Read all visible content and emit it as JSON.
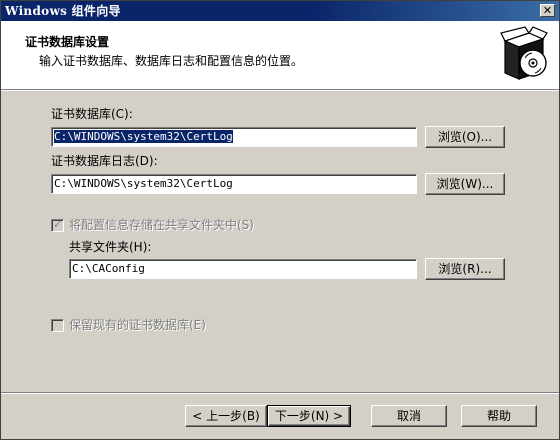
{
  "window": {
    "title": "Windows 组件向导",
    "close_glyph": "✕"
  },
  "header": {
    "title": "证书数据库设置",
    "subtitle": "输入证书数据库、数据库日志和配置信息的位置。",
    "icon": "setup-box-cd-icon"
  },
  "fields": {
    "db_label": "证书数据库(C):",
    "db_value": "C:\\WINDOWS\\system32\\CertLog",
    "db_browse": "浏览(O)...",
    "log_label": "证书数据库日志(D):",
    "log_value": "C:\\WINDOWS\\system32\\CertLog",
    "log_browse": "浏览(W)...",
    "share_check_label": "将配置信息存储在共享文件夹中(S)",
    "share_folder_label": "共享文件夹(H):",
    "share_folder_value": "C:\\CAConfig",
    "share_browse": "浏览(R)...",
    "keep_existing_label": "保留现有的证书数据库(E)"
  },
  "buttons": {
    "back": "< 上一步(B)",
    "next": "下一步(N) >",
    "cancel": "取消",
    "help": "帮助"
  },
  "colors": {
    "titlebar": "#0a246a",
    "selection": "#0a246a",
    "face": "#d4d0c8"
  }
}
